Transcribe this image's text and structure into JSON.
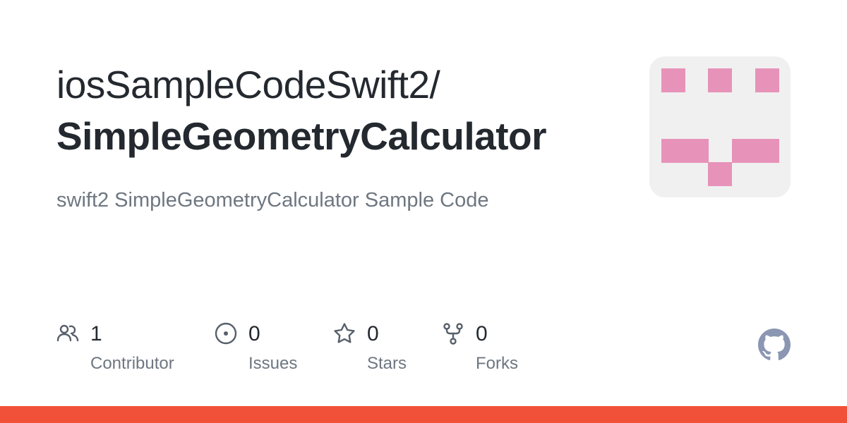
{
  "repo": {
    "owner": "iosSampleCodeSwift2/",
    "name": "SimpleGeometryCalculator",
    "description": "swift2 SimpleGeometryCalculator Sample Code"
  },
  "avatar": {
    "background": "#f0f0f0",
    "block_color": "#e793b9"
  },
  "stats": [
    {
      "icon": "people-icon",
      "count": "1",
      "label": "Contributor"
    },
    {
      "icon": "issue-opened-icon",
      "count": "0",
      "label": "Issues"
    },
    {
      "icon": "star-icon",
      "count": "0",
      "label": "Stars"
    },
    {
      "icon": "repo-forked-icon",
      "count": "0",
      "label": "Forks"
    }
  ],
  "brand": {
    "logo_icon": "github-mark-icon",
    "logo_color": "#8b96b2",
    "accent_bar_color": "#f05138"
  },
  "colors": {
    "primary_text": "#24292f",
    "muted_text": "#6e7781",
    "icon_color": "#57606a"
  }
}
